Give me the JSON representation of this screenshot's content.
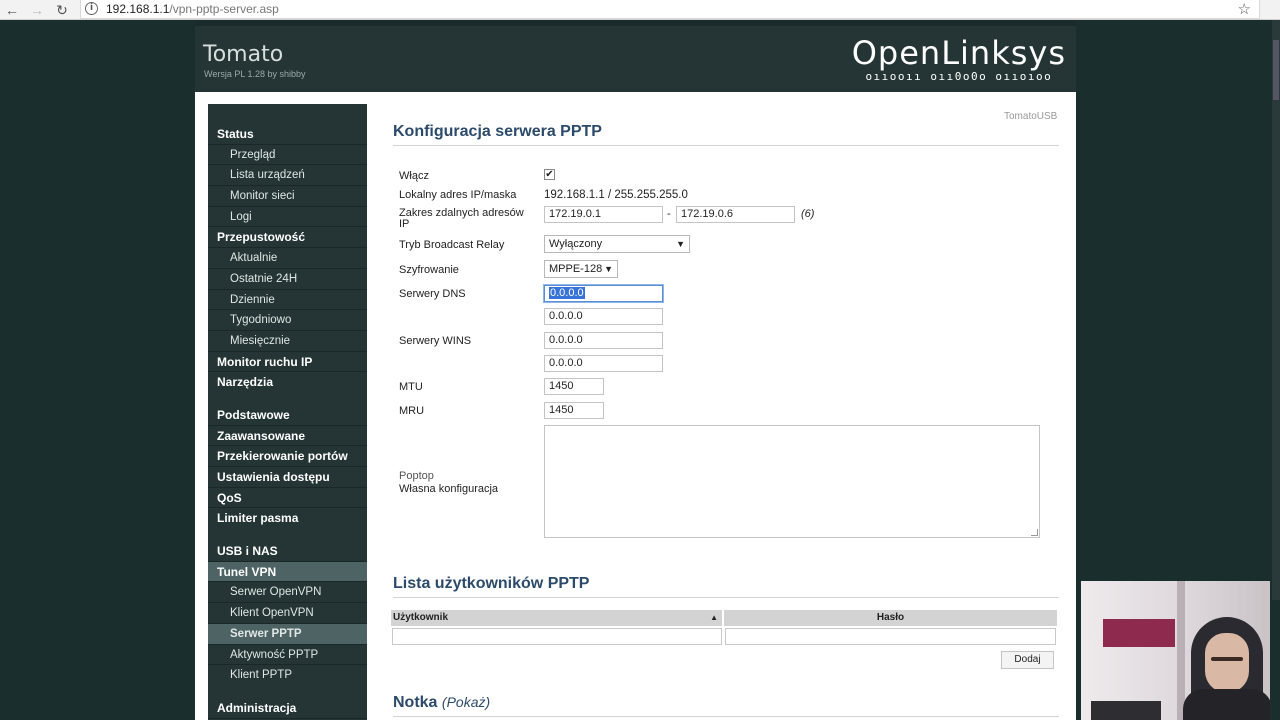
{
  "browser": {
    "url_host": "192.168.1.1",
    "url_path": "/vpn-pptp-server.asp",
    "back_icon": "arrow-left-icon",
    "forward_icon": "arrow-right-icon",
    "reload_icon": "reload-icon",
    "info_icon": "info-icon",
    "star_icon": "star-icon"
  },
  "header": {
    "title": "Tomato",
    "version": "Wersja PL 1.28 by shibby",
    "logo_name": "OpenLinksys",
    "logo_binary": "oııooıı oıı0o0o oııoıoo"
  },
  "sidebar": {
    "items": [
      {
        "label": "Status"
      },
      {
        "label": "Przegląd"
      },
      {
        "label": "Lista urządzeń"
      },
      {
        "label": "Monitor sieci"
      },
      {
        "label": "Logi"
      },
      {
        "label": "Przepustowość"
      },
      {
        "label": "Aktualnie"
      },
      {
        "label": "Ostatnie 24H"
      },
      {
        "label": "Dziennie"
      },
      {
        "label": "Tygodniowo"
      },
      {
        "label": "Miesięcznie"
      },
      {
        "label": "Monitor ruchu IP"
      },
      {
        "label": "Narzędzia"
      },
      {
        "label": "Podstawowe"
      },
      {
        "label": "Zaawansowane"
      },
      {
        "label": "Przekierowanie portów"
      },
      {
        "label": "Ustawienia dostępu"
      },
      {
        "label": "QoS"
      },
      {
        "label": "Limiter pasma"
      },
      {
        "label": "USB i NAS"
      },
      {
        "label": "Tunel VPN"
      },
      {
        "label": "Serwer OpenVPN"
      },
      {
        "label": "Klient OpenVPN"
      },
      {
        "label": "Serwer PPTP"
      },
      {
        "label": "Aktywność PPTP"
      },
      {
        "label": "Klient PPTP"
      },
      {
        "label": "Administracja"
      }
    ]
  },
  "main": {
    "corner_label": "TomatoUSB",
    "section_title": "Konfiguracja serwera PPTP",
    "fields": {
      "enable_label": "Włącz",
      "enable_checked": true,
      "local_ip_label": "Lokalny adres IP/maska",
      "local_ip_value": "192.168.1.1 / 255.255.255.0",
      "remote_range_label": "Zakres zdalnych adresów IP",
      "remote_range_start": "172.19.0.1",
      "remote_range_dash": "-",
      "remote_range_end": "172.19.0.6",
      "remote_range_count": "(6)",
      "broadcast_label": "Tryb Broadcast Relay",
      "broadcast_value": "Wyłączony",
      "encryption_label": "Szyfrowanie",
      "encryption_value": "MPPE-128",
      "dns_label": "Serwery DNS",
      "dns_1": "0.0.0.0",
      "dns_2": "0.0.0.0",
      "wins_label": "Serwery WINS",
      "wins_1": "0.0.0.0",
      "wins_2": "0.0.0.0",
      "mtu_label": "MTU",
      "mtu_value": "1450",
      "mru_label": "MRU",
      "mru_value": "1450",
      "custom_label_1": "Poptop",
      "custom_label_2": "Własna konfiguracja"
    },
    "users_title": "Lista użytkowników PPTP",
    "users_columns": [
      "Użytkownik",
      "Hasło"
    ],
    "users_sort_icon": "sort-asc-icon",
    "add_button": "Dodaj",
    "notes_title": "Notka",
    "notes_toggle": "(Pokaż)"
  },
  "colors": {
    "header_bg": "#253535",
    "menu_active_bg": "#4e6464",
    "section_title": "#2c4a6a"
  }
}
